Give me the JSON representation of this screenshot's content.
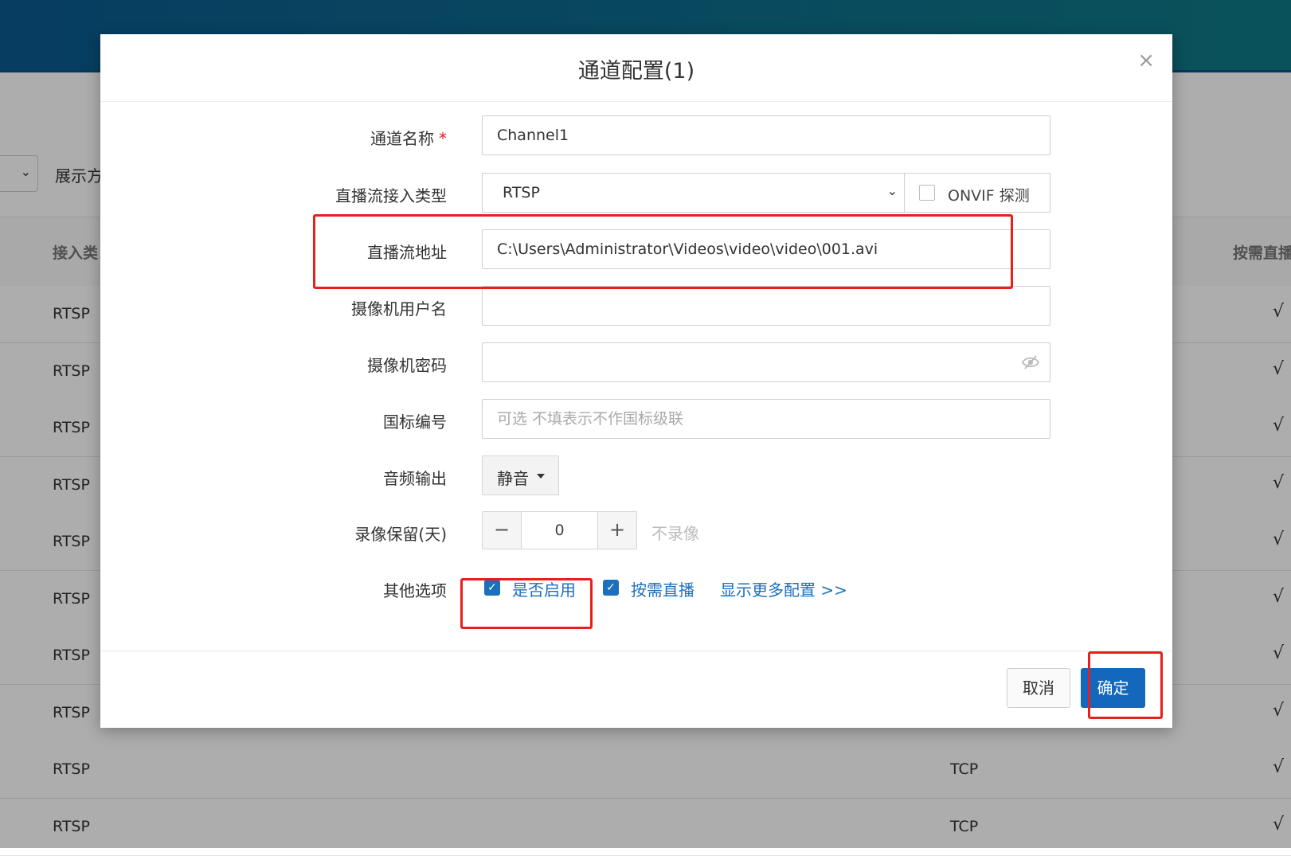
{
  "background": {
    "filter_label": "展示方",
    "table_headers": [
      "接入类",
      "按需直播"
    ],
    "rows": [
      {
        "type": "RTSP",
        "proto": "",
        "check": "√"
      },
      {
        "type": "RTSP",
        "proto": "",
        "check": "√"
      },
      {
        "type": "RTSP",
        "proto": "",
        "check": "√"
      },
      {
        "type": "RTSP",
        "proto": "",
        "check": "√"
      },
      {
        "type": "RTSP",
        "proto": "",
        "check": "√"
      },
      {
        "type": "RTSP",
        "proto": "",
        "check": "√"
      },
      {
        "type": "RTSP",
        "proto": "",
        "check": "√"
      },
      {
        "type": "RTSP",
        "proto": "",
        "check": "√"
      },
      {
        "type": "RTSP",
        "proto": "TCP",
        "check": "√"
      },
      {
        "type": "RTSP",
        "proto": "TCP",
        "check": "√"
      }
    ]
  },
  "modal": {
    "title": "通道配置(1)",
    "close": "×",
    "fields": {
      "channel_name": {
        "label": "通道名称",
        "required_mark": "*",
        "value": "Channel1"
      },
      "stream_type": {
        "label": "直播流接入类型",
        "value": "RTSP",
        "onvif_label": "ONVIF 探测"
      },
      "stream_url": {
        "label": "直播流地址",
        "value": "C:\\Users\\Administrator\\Videos\\video\\video\\001.avi"
      },
      "camera_user": {
        "label": "摄像机用户名",
        "value": ""
      },
      "camera_password": {
        "label": "摄像机密码",
        "value": ""
      },
      "gb_code": {
        "label": "国标编号",
        "value": "",
        "placeholder": "可选 不填表示不作国标级联"
      },
      "audio_output": {
        "label": "音频输出",
        "value": "静音"
      },
      "record_keep": {
        "label": "录像保留(天)",
        "minus": "−",
        "value": "0",
        "plus": "+",
        "note": "不录像"
      },
      "other_options": {
        "label": "其他选项",
        "enable_label": "是否启用",
        "on_demand_label": "按需直播",
        "more_link": "显示更多配置 >>"
      }
    },
    "buttons": {
      "cancel": "取消",
      "ok": "确定"
    }
  }
}
